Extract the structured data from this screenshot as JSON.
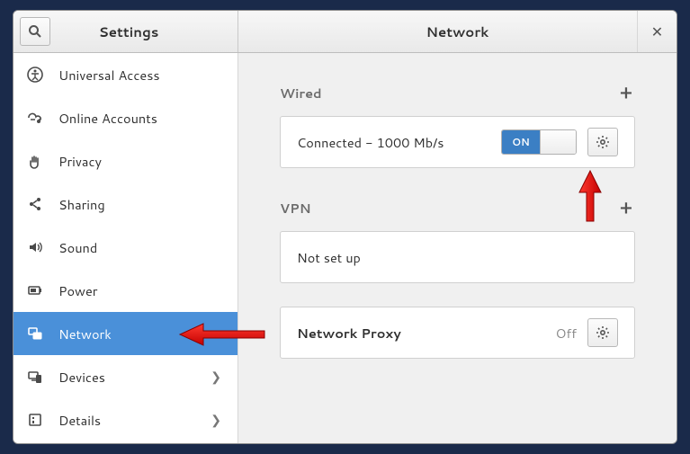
{
  "titlebar": {
    "left_title": "Settings",
    "right_title": "Network"
  },
  "sidebar": {
    "items": [
      {
        "label": "Universal Access",
        "chevron": false
      },
      {
        "label": "Online Accounts",
        "chevron": false
      },
      {
        "label": "Privacy",
        "chevron": false
      },
      {
        "label": "Sharing",
        "chevron": false
      },
      {
        "label": "Sound",
        "chevron": false
      },
      {
        "label": "Power",
        "chevron": false
      },
      {
        "label": "Network",
        "chevron": false,
        "selected": true
      },
      {
        "label": "Devices",
        "chevron": true
      },
      {
        "label": "Details",
        "chevron": true
      }
    ]
  },
  "content": {
    "wired": {
      "title": "Wired",
      "status": "Connected - 1000 Mb/s",
      "switch_label": "ON",
      "switch_on": true
    },
    "vpn": {
      "title": "VPN",
      "status": "Not set up"
    },
    "proxy": {
      "label": "Network Proxy",
      "value": "Off"
    }
  }
}
